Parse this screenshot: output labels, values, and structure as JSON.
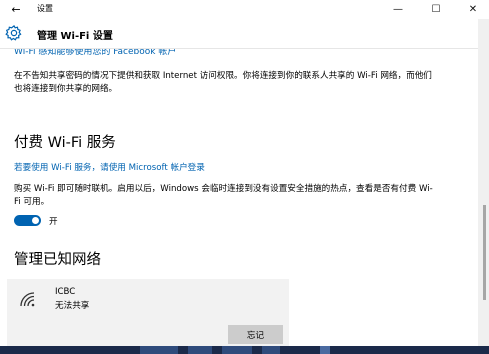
{
  "window": {
    "back_glyph": "←",
    "app_title": "设置",
    "minimize_glyph": "—",
    "maximize_glyph": "☐",
    "close_glyph": "✕"
  },
  "header": {
    "icon": "gear-icon",
    "title": "管理 Wi-Fi 设置"
  },
  "content": {
    "cut_link": "Wi-Fi 感知能够使用您的 Facebook 帐户",
    "paragraph1": "在不告知共享密码的情况下提供和获取 Internet 访问权限。你将连接到你的联系人共享的 Wi-Fi 网络，而他们也将连接到你共享的网络。",
    "paid_section": {
      "title": "付费 Wi-Fi 服务",
      "link": "若要使用 Wi-Fi 服务，请使用 Microsoft 帐户登录",
      "description": "购买 Wi-Fi 即可随时联机。启用以后，Windows 会临时连接到没有设置安全措施的热点，查看是否有付费 Wi-Fi 可用。",
      "toggle_state": "on",
      "toggle_label": "开"
    },
    "known_networks": {
      "title": "管理已知网络",
      "networks": [
        {
          "icon": "wifi-signal-icon",
          "name": "ICBC",
          "status": "无法共享",
          "forget_label": "忘记"
        }
      ]
    }
  },
  "colors": {
    "accent": "#0063b1",
    "card_bg": "#f2f2f2",
    "button_bg": "#cccccc"
  }
}
